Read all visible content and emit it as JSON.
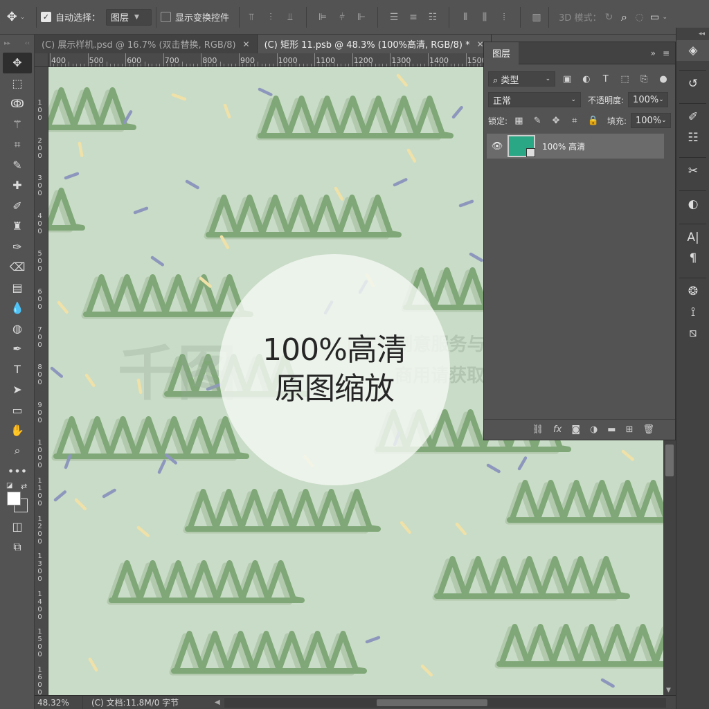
{
  "option_bar": {
    "auto_select_label": "自动选择：",
    "auto_select_target": "图层",
    "show_transform_label": "显示变换控件",
    "mode_3d_label": "3D 模式："
  },
  "tabs": [
    {
      "label": "(C) 展示样机.psd @ 16.7% (双击替换, RGB/8)",
      "close": "✕",
      "active": false
    },
    {
      "label": "(C) 矩形 11.psb @ 48.3% (100%高清, RGB/8) *",
      "close": "✕",
      "active": true
    }
  ],
  "ruler": {
    "h_labels": [
      "400",
      "500",
      "600",
      "700",
      "800",
      "900",
      "1000",
      "1100",
      "1200",
      "1300",
      "1400",
      "1500"
    ],
    "v_labels": [
      "1 0 0",
      "2 0 0",
      "3 0 0",
      "4 0 0",
      "5 0 0",
      "6 0 0",
      "7 0 0",
      "8 0 0",
      "9 0 0",
      "1 0 0 0",
      "1 1 0 0",
      "1 2 0 0",
      "1 3 0 0",
      "1 4 0 0",
      "1 5 0 0",
      "1 6 0 0"
    ]
  },
  "canvas": {
    "background": "#c9dcc7",
    "zigzag_color": "#7fa777",
    "badge_line1": "100%高清",
    "badge_line2": "原图缩放",
    "watermark_line1": "| 素材创意服务与协作平台",
    "watermark_line2": "商用请获取授权",
    "watermark_logo": "千图"
  },
  "status_bar": {
    "zoom": "48.32%",
    "doc_info": "(C) 文档:11.8M/0 字节"
  },
  "layers_panel": {
    "title": "图层",
    "filter_kind": "类型",
    "blend_mode": "正常",
    "opacity_label": "不透明度:",
    "opacity_value": "100%",
    "lock_label": "锁定:",
    "fill_label": "填充:",
    "fill_value": "100%",
    "layer_name": "100% 高清",
    "layer_thumb_color": "#2aa785"
  },
  "icons": {
    "move": "move-icon",
    "fx": "fx",
    "collapse": "»",
    "menu": "≡"
  }
}
